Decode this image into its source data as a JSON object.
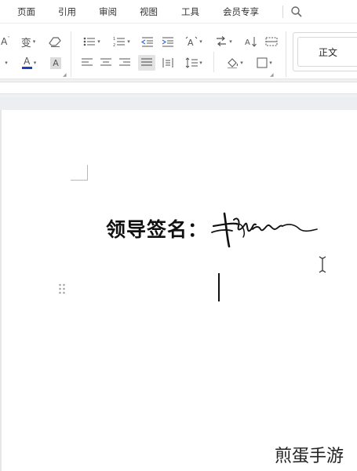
{
  "menu": {
    "items": [
      "页面",
      "引用",
      "审阅",
      "视图",
      "工具",
      "会员专享"
    ],
    "search_icon": "search-icon"
  },
  "ribbon": {
    "font_size_label": "A",
    "char_label": "变",
    "font_color_label": "A",
    "highlight_label": "A",
    "style_name": "正文",
    "icons": [
      "font-size-decrease-icon",
      "phonetic-guide-icon",
      "clear-format-icon",
      "bullet-list-icon",
      "numbered-list-icon",
      "decrease-indent-icon",
      "increase-indent-icon",
      "text-direction-icon",
      "chinese-layout-icon",
      "sort-icon",
      "table-borders-icon",
      "align-left-icon",
      "align-center-icon",
      "align-right-icon",
      "justify-icon",
      "distributed-icon",
      "line-spacing-icon",
      "shading-icon",
      "borders-icon"
    ],
    "accent_font_color": "#1a3fbf"
  },
  "document": {
    "signature_label": "领导签名：",
    "signature_image": "handwritten-signature"
  },
  "watermark": "煎蛋手游"
}
